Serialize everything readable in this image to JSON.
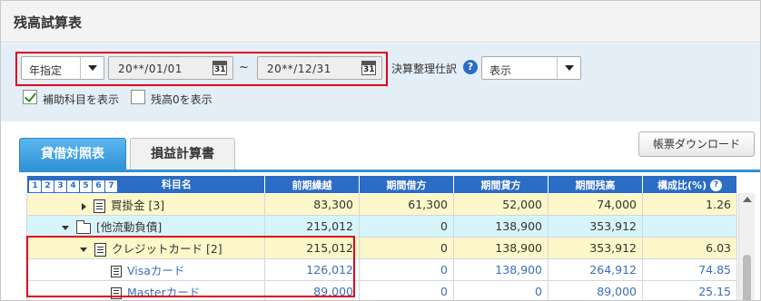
{
  "window": {
    "title": "残高試算表"
  },
  "filters": {
    "period_type": "年指定",
    "date_from": "20**/01/01",
    "date_to": "20**/12/31",
    "separator": "~",
    "closing_entry_label": "決算整理仕訳",
    "closing_entry_value": "表示",
    "show_sub_accounts_label": "補助科目を表示",
    "show_sub_accounts_checked": true,
    "show_zero_balance_label": "残高0を表示",
    "show_zero_balance_checked": false,
    "calendar_icon_text": "31"
  },
  "tabs": [
    {
      "label": "貸借対照表",
      "active": true
    },
    {
      "label": "損益計算書",
      "active": false
    }
  ],
  "download_button": "帳票ダウンロード",
  "table": {
    "level_buttons": [
      "1",
      "2",
      "3",
      "4",
      "5",
      "6",
      "7"
    ],
    "columns": [
      "科目名",
      "前期繰越",
      "期間借方",
      "期間貸方",
      "期間残高",
      "構成比(%)"
    ],
    "rows": [
      {
        "name": "買掛金 [3]",
        "prev": "83,300",
        "debit": "61,300",
        "credit": "52,000",
        "balance": "74,000",
        "ratio": "1.26"
      },
      {
        "name": "[他流動負債]",
        "prev": "215,012",
        "debit": "0",
        "credit": "138,900",
        "balance": "353,912",
        "ratio": ""
      },
      {
        "name": "クレジットカード [2]",
        "prev": "215,012",
        "debit": "0",
        "credit": "138,900",
        "balance": "353,912",
        "ratio": "6.03"
      },
      {
        "name": "Visaカード",
        "prev": "126,012",
        "debit": "0",
        "credit": "138,900",
        "balance": "264,912",
        "ratio": "74.85"
      },
      {
        "name": "Masterカード",
        "prev": "89,000",
        "debit": "0",
        "credit": "0",
        "balance": "89,000",
        "ratio": "25.15"
      }
    ]
  },
  "colors": {
    "accent": "#e0001b",
    "header_blue": "#2b6cc4",
    "tab_blue": "#2f93d6",
    "row_yellow": "#fdf7c9",
    "row_cyan": "#d8f4fb",
    "link_blue": "#3a6fb8"
  }
}
